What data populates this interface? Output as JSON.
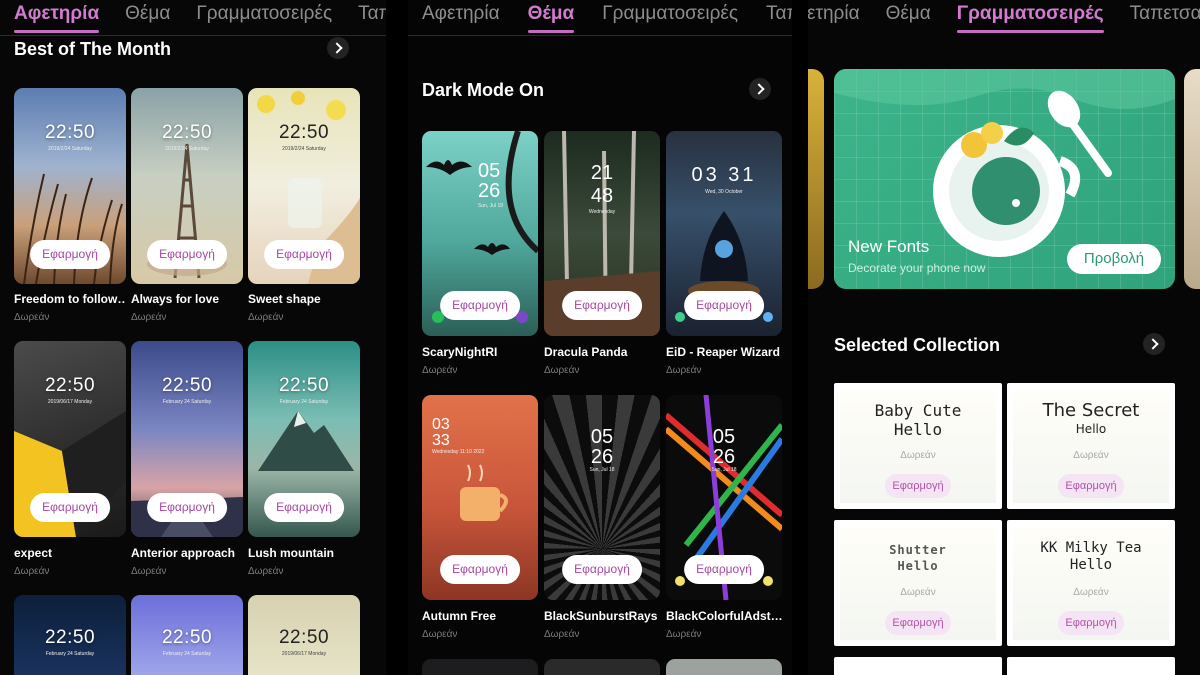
{
  "colors": {
    "accent": "#c56cc3",
    "apply_text": "#a6479f",
    "banner_green": "#3db48a"
  },
  "panel1": {
    "tabs": [
      "Αφετηρία",
      "Θέμα",
      "Γραμματοσειρές",
      "Ταπετσαρίες"
    ],
    "section_title": "Best of The Month",
    "cards": [
      {
        "time": "22:50",
        "date": "2019/2/24 Saturday",
        "apply": "Εφαρμογή",
        "name": "Freedom to follow…",
        "price": "Δωρεάν"
      },
      {
        "time": "22:50",
        "date": "2019/2/24 Saturday",
        "apply": "Εφαρμογή",
        "name": "Always for love",
        "price": "Δωρεάν"
      },
      {
        "time": "22:50",
        "date": "2019/2/24 Saturday",
        "apply": "Εφαρμογή",
        "name": "Sweet shape",
        "price": "Δωρεάν"
      },
      {
        "time": "22:50",
        "date": "2019/06/17 Monday",
        "apply": "Εφαρμογή",
        "name": "expect",
        "price": "Δωρεάν"
      },
      {
        "time": "22:50",
        "date": "February 24 Saturday",
        "apply": "Εφαρμογή",
        "name": "Anterior approach",
        "price": "Δωρεάν"
      },
      {
        "time": "22:50",
        "date": "February 24 Saturday",
        "apply": "Εφαρμογή",
        "name": "Lush mountain",
        "price": "Δωρεάν"
      },
      {
        "time": "22:50",
        "date": "February 24 Saturday"
      },
      {
        "time": "22:50",
        "date": "February 24 Saturday"
      },
      {
        "time": "22:50",
        "date": "2019/06/17 Monday"
      }
    ]
  },
  "panel2": {
    "tabs": [
      "Αφετηρία",
      "Θέμα",
      "Γραμματοσειρές",
      "Ταπετσαρίες"
    ],
    "section_title": "Dark Mode On",
    "cards": [
      {
        "time_top": "05",
        "time_bottom": "26",
        "date": "Sun, Jul 18",
        "apply": "Εφαρμογή",
        "name": "ScaryNightRI",
        "price": "Δωρεάν"
      },
      {
        "time_top": "21",
        "time_bottom": "48",
        "date": "Wednesday",
        "apply": "Εφαρμογή",
        "name": "Dracula Panda",
        "price": "Δωρεάν"
      },
      {
        "time_top": "03 31",
        "time_bottom": "",
        "date": "Wed, 30 October",
        "apply": "Εφαρμογή",
        "name": "EiD - Reaper Wizard",
        "price": "Δωρεάν"
      },
      {
        "time_top": "03",
        "time_bottom": "33",
        "date": "Wednesday 11:10 2022",
        "apply": "Εφαρμογή",
        "name": "Autumn Free",
        "price": "Δωρεάν"
      },
      {
        "time_top": "05",
        "time_bottom": "26",
        "date": "Sun, Jul 18",
        "apply": "Εφαρμογή",
        "name": "BlackSunburstRays",
        "price": "Δωρεάν"
      },
      {
        "time_top": "05",
        "time_bottom": "26",
        "date": "Sun, Jul 18",
        "apply": "Εφαρμογή",
        "name": "BlackColorfulAdst…",
        "price": "Δωρεάν"
      }
    ]
  },
  "panel3": {
    "tabs": [
      "Αφετηρία",
      "Θέμα",
      "Γραμματοσειρές",
      "Ταπετσαρίες"
    ],
    "banner": {
      "title": "New Fonts",
      "subtitle": "Decorate your phone now",
      "button": "Προβολή"
    },
    "section_title": "Selected Collection",
    "fonts": [
      {
        "sample_line1": "Baby Cute",
        "sample_line2": "Hello",
        "price": "Δωρεάν",
        "apply": "Εφαρμογή"
      },
      {
        "sample_line1": "The Secret",
        "sample_line2": "Hello",
        "price": "Δωρεάν",
        "apply": "Εφαρμογή"
      },
      {
        "sample_line1": "Shutter",
        "sample_line2": "Hello",
        "price": "Δωρεάν",
        "apply": "Εφαρμογή"
      },
      {
        "sample_line1": "KK Milky Tea",
        "sample_line2": "Hello",
        "price": "Δωρεάν",
        "apply": "Εφαρμογή"
      }
    ]
  }
}
